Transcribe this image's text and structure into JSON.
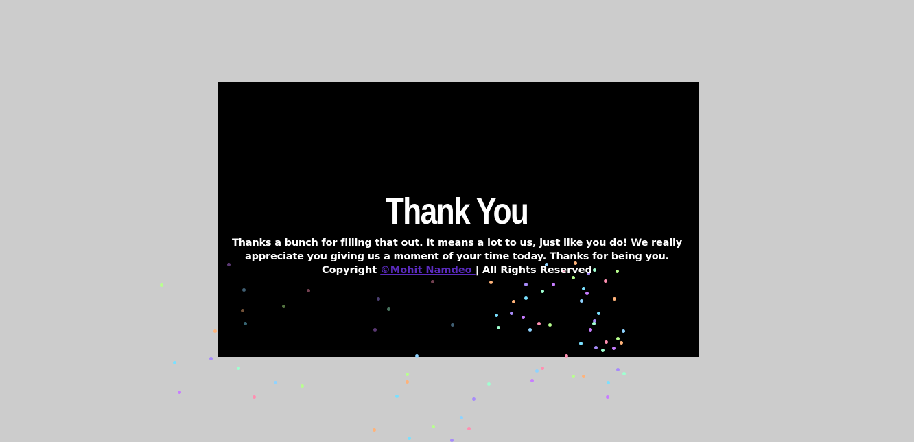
{
  "thankyou": {
    "title": "Thank You",
    "message": "Thanks a bunch for filling that out. It means a lot to us, just like you do! We really appreciate you giving us a moment of your time today. Thanks for being you.",
    "copyright_prefix": "Copyright ",
    "author_link": "©Mohit Namdeo ",
    "copyright_suffix": "| All Rights Reserved"
  },
  "colors": {
    "page_background": "#cccccc",
    "card_background": "#000000",
    "text": "#ffffff",
    "link": "#5b2bbf"
  }
}
